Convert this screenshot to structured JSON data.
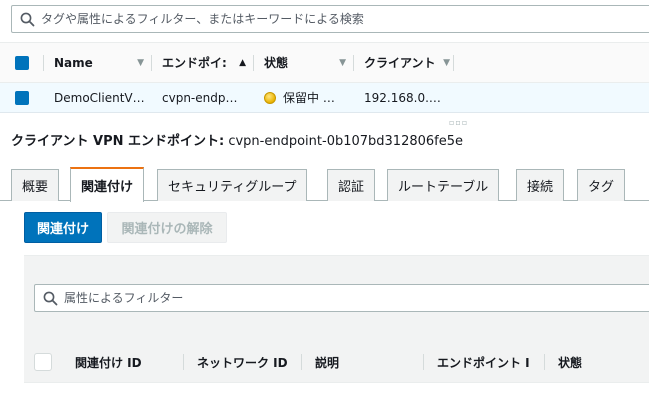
{
  "search": {
    "placeholder": "タグや属性によるフィルター、またはキーワードによる検索"
  },
  "endpoints_table": {
    "columns": [
      "Name",
      "エンドポイ:",
      "状態",
      "クライアント"
    ],
    "rows": [
      {
        "name": "DemoClientV…",
        "endpoint": "cvpn-endp…",
        "state": "保留中 …",
        "client_cidr": "192.168.0.…"
      }
    ]
  },
  "detail": {
    "label": "クライアント VPN エンドポイント:",
    "endpoint_id": "cvpn-endpoint-0b107bd312806fe5e"
  },
  "tabs": [
    {
      "label": "概要",
      "active": false
    },
    {
      "label": "関連付け",
      "active": true
    },
    {
      "label": "セキュリティグループ",
      "active": false
    },
    {
      "label": "認証",
      "active": false
    },
    {
      "label": "ルートテーブル",
      "active": false
    },
    {
      "label": "接続",
      "active": false
    },
    {
      "label": "タグ",
      "active": false
    }
  ],
  "actions": {
    "associate": "関連付け",
    "disassociate": "関連付けの解除"
  },
  "associations": {
    "filter_placeholder": "属性によるフィルター",
    "columns": [
      "関連付け ID",
      "ネットワーク ID",
      "説明",
      "エンドポイント I",
      "状態"
    ]
  },
  "colors": {
    "primary": "#0073bb",
    "active_tab_accent": "#ec7211",
    "selected_row": "#f1faff",
    "pending_state": "#e9b200"
  },
  "icons": [
    "search-icon",
    "sort-caret-icon",
    "status-pending-icon"
  ]
}
